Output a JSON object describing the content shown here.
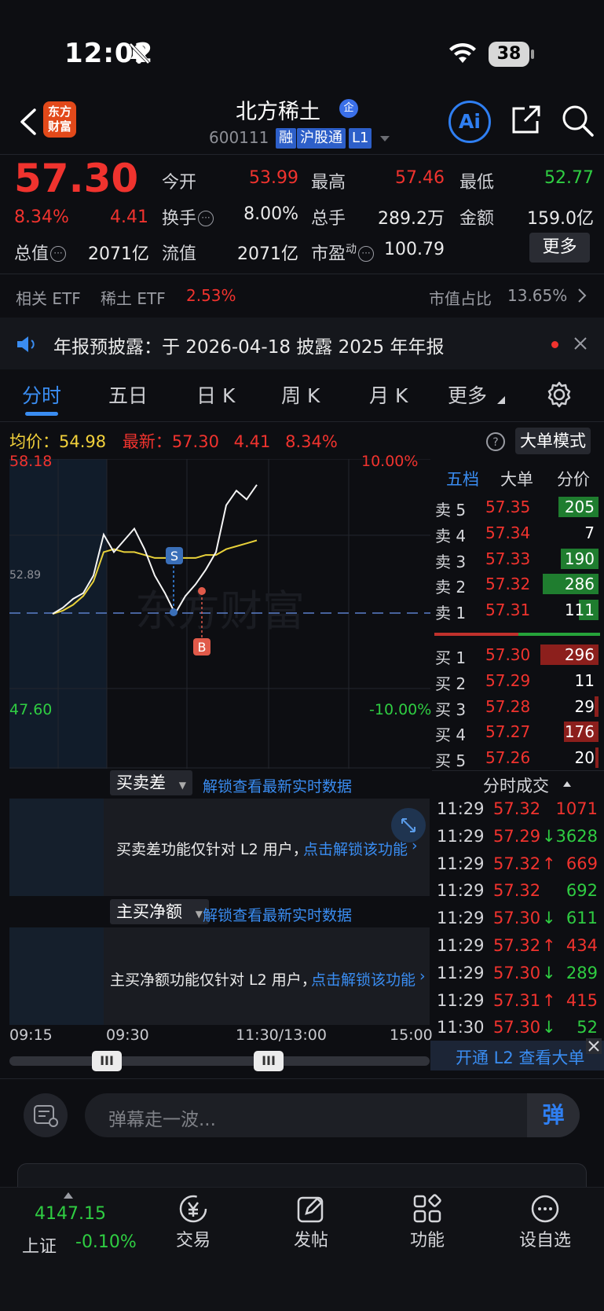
{
  "status_bar": {
    "time": "12:02",
    "battery": "38"
  },
  "header": {
    "stock_name": "北方稀土",
    "stock_name_tag": "企",
    "stock_code": "600111",
    "tags": [
      "融",
      "沪股通",
      "L1"
    ],
    "logo_line1": "东方",
    "logo_line2": "财富",
    "ai_label": "Ai"
  },
  "quote": {
    "price": "57.30",
    "change_pct": "8.34%",
    "change": "4.41",
    "open_label": "今开",
    "open": "53.99",
    "high_label": "最高",
    "high": "57.46",
    "low_label": "最低",
    "low": "52.77",
    "turnover_label": "换手",
    "turnover": "8.00%",
    "volume_label": "总手",
    "volume": "289.2万",
    "amount_label": "金额",
    "amount": "159.0亿",
    "mktcap_label": "总值",
    "mktcap": "2071亿",
    "float_label": "流值",
    "float": "2071亿",
    "pe_label": "市盈",
    "pe_sup": "动",
    "pe": "100.79",
    "more_label": "更多"
  },
  "etf_row": {
    "related_label": "相关 ETF",
    "etf_name": "稀土 ETF",
    "etf_change": "2.53%",
    "share_label": "市值占比",
    "share_value": "13.65%"
  },
  "notice": {
    "text": "年报预披露：于 2026-04-18 披露 2025 年年报"
  },
  "tabs": [
    "分时",
    "五日",
    "日 K",
    "周 K",
    "月 K",
    "更多"
  ],
  "avg_row": {
    "avg_label": "均价：",
    "avg": "54.98",
    "latest_label": "最新：",
    "latest": "57.30",
    "change": "4.41",
    "change_pct": "8.34%",
    "big_order_mode": "大单模式"
  },
  "chart_axes": {
    "top_price": "58.18",
    "bottom_price": "47.60",
    "prev_close_label": "52.89",
    "top_pct": "10.00%",
    "bottom_pct": "-10.00%",
    "marker_s": "S",
    "marker_b": "B",
    "watermark": "东方财富"
  },
  "chart_data": {
    "type": "line",
    "ylim": [
      47.6,
      58.18
    ],
    "prev_close": 52.89,
    "series": [
      {
        "name": "价格",
        "values": [
          52.89,
          53.1,
          53.4,
          53.6,
          54.2,
          55.6,
          55.0,
          55.4,
          55.8,
          55.1,
          54.2,
          53.6,
          52.9,
          53.5,
          53.9,
          54.4,
          55.0,
          56.6,
          57.1,
          56.8,
          57.3
        ]
      },
      {
        "name": "均价",
        "values": [
          52.89,
          53.0,
          53.2,
          53.5,
          54.0,
          55.0,
          55.1,
          55.0,
          55.0,
          54.9,
          54.8,
          54.8,
          54.8,
          54.8,
          54.8,
          54.9,
          54.9,
          55.1,
          55.2,
          55.3,
          55.4
        ]
      }
    ]
  },
  "order_book": {
    "tabs": [
      "五档",
      "大单",
      "分价"
    ],
    "asks": [
      {
        "label": "卖 5",
        "price": "57.35",
        "vol": "205",
        "bar": 0.41
      },
      {
        "label": "卖 4",
        "price": "57.34",
        "vol": "7",
        "bar": 0.0
      },
      {
        "label": "卖 3",
        "price": "57.33",
        "vol": "190",
        "bar": 0.38
      },
      {
        "label": "卖 2",
        "price": "57.32",
        "vol": "286",
        "bar": 0.57
      },
      {
        "label": "卖 1",
        "price": "57.31",
        "vol": "111",
        "bar": 0.2
      }
    ],
    "bids": [
      {
        "label": "买 1",
        "price": "57.30",
        "vol": "296",
        "bar": 0.59
      },
      {
        "label": "买 2",
        "price": "57.29",
        "vol": "11",
        "bar": 0.0
      },
      {
        "label": "买 3",
        "price": "57.28",
        "vol": "29",
        "bar": 0.04
      },
      {
        "label": "买 4",
        "price": "57.27",
        "vol": "176",
        "bar": 0.35
      },
      {
        "label": "买 5",
        "price": "57.26",
        "vol": "20",
        "bar": 0.03
      }
    ]
  },
  "trades": {
    "title": "分时成交",
    "rows": [
      {
        "time": "11:29",
        "price": "57.32",
        "dir": "",
        "vol": "1071",
        "vcolor": "red"
      },
      {
        "time": "11:29",
        "price": "57.29",
        "dir": "↓",
        "vol": "3628",
        "vcolor": "green"
      },
      {
        "time": "11:29",
        "price": "57.32",
        "dir": "↑",
        "vol": "669",
        "vcolor": "red"
      },
      {
        "time": "11:29",
        "price": "57.32",
        "dir": "",
        "vol": "692",
        "vcolor": "green"
      },
      {
        "time": "11:29",
        "price": "57.30",
        "dir": "↓",
        "vol": "611",
        "vcolor": "green"
      },
      {
        "time": "11:29",
        "price": "57.32",
        "dir": "↑",
        "vol": "434",
        "vcolor": "red"
      },
      {
        "time": "11:29",
        "price": "57.30",
        "dir": "↓",
        "vol": "289",
        "vcolor": "green"
      },
      {
        "time": "11:29",
        "price": "57.31",
        "dir": "↑",
        "vol": "415",
        "vcolor": "red"
      },
      {
        "time": "11:30",
        "price": "57.30",
        "dir": "↓",
        "vol": "52",
        "vcolor": "green"
      }
    ],
    "l2_banner": "开通 L2 查看大单"
  },
  "panels": {
    "p1_title": "买卖差",
    "p1_unlock": "解锁查看最新实时数据",
    "p1_msg": "买卖差功能仅针对 L2 用户，",
    "p1_link": "点击解锁该功能",
    "p2_title": "主买净额",
    "p2_unlock": "解锁查看最新实时数据",
    "p2_msg": "主买净额功能仅针对 L2 用户，",
    "p2_link": "点击解锁该功能"
  },
  "time_axis": [
    "09:15",
    "09:30",
    "11:30/13:00",
    "15:00"
  ],
  "slider": {
    "handle_glyph": "III"
  },
  "danmaku": {
    "placeholder": "弹幕走一波...",
    "send": "弹"
  },
  "bottom_nav": {
    "index_value": "4147.15",
    "index_name": "上证",
    "index_change": "-0.10%",
    "items": [
      "交易",
      "发帖",
      "功能",
      "设自选"
    ]
  }
}
